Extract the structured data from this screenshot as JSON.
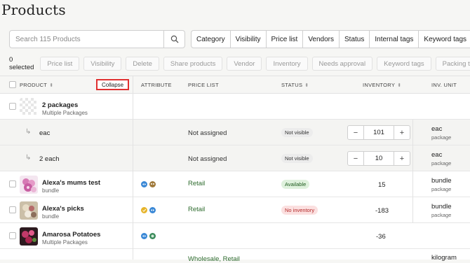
{
  "page": {
    "title": "Products"
  },
  "search": {
    "placeholder": "Search 115 Products",
    "value": ""
  },
  "filters": [
    "Category",
    "Visibility",
    "Price list",
    "Vendors",
    "Status",
    "Internal tags",
    "Keyword tags"
  ],
  "actions": {
    "selected_label": "0 selected",
    "buttons": [
      "Price list",
      "Visibility",
      "Delete",
      "Share products",
      "Vendor",
      "Inventory",
      "Needs approval",
      "Keyword tags",
      "Packing tags"
    ]
  },
  "table": {
    "headers": {
      "product": "PRODUCT",
      "collapse": "Collapse",
      "attribute": "ATTRIBUTE",
      "price_list": "PRICE LIST",
      "status": "STATUS",
      "inventory": "INVENTORY",
      "inv_unit": "INV. UNIT"
    },
    "rows": [
      {
        "name": "2 packages",
        "sub": "Multiple Packages"
      },
      {
        "name": "eac",
        "price_list": "Not assigned",
        "status": "Not visible",
        "inventory": "101",
        "unit": "eac",
        "unit_sub": "package"
      },
      {
        "name": "2 each",
        "price_list": "Not assigned",
        "status": "Not visible",
        "inventory": "10",
        "unit": "eac",
        "unit_sub": "package"
      },
      {
        "name": "Alexa's mums test",
        "sub": "bundle",
        "price_list": "Retail",
        "status": "Available",
        "inventory": "15",
        "unit": "bundle",
        "unit_sub": "package"
      },
      {
        "name": "Alexa's picks",
        "sub": "bundle",
        "price_list": "Retail",
        "status": "No inventory",
        "inventory": "-183",
        "unit": "bundle",
        "unit_sub": "package"
      },
      {
        "name": "Amarosa Potatoes",
        "sub": "Multiple Packages",
        "inventory": "-36"
      },
      {
        "price_list": "Wholesale, Retail",
        "unit": "kilogram"
      }
    ]
  },
  "icons": {
    "search": "search-icon",
    "sort": "sort-icon",
    "sub_arrow": "subdirectory-arrow-icon",
    "minus": "minus-icon",
    "plus": "plus-icon"
  },
  "colors": {
    "available_bg": "#dff1dd",
    "no_inventory_bg": "#fbe0e0",
    "not_visible_bg": "#ececec",
    "price_green": "#2e6b2e",
    "collapse_outline": "#e03030"
  }
}
